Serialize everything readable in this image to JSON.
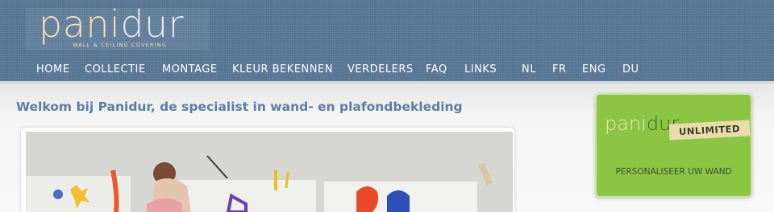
{
  "logo": {
    "pan": "pani",
    "dur": "dur",
    "tagline": "WALL & CEILING COVERING"
  },
  "nav": {
    "items": [
      "HOME",
      "COLLECTIE",
      "MONTAGE",
      "KLEUR BEKENNEN",
      "VERDELERS",
      "FAQ",
      "LINKS"
    ],
    "languages": [
      "NL",
      "FR",
      "ENG",
      "DU"
    ]
  },
  "main": {
    "welcome_title": "Welkom bij Panidur, de specialist in wand- en plafondbekleding"
  },
  "promo": {
    "logo_pan": "pani",
    "logo_dur": "dur",
    "badge": "UNLIMITED",
    "cta": "PERSONALISEER UW WAND"
  },
  "colors": {
    "header": "#587593",
    "title": "#5b7ea3",
    "promo_bg": "#8cc544",
    "logo_cream": "#f3e1b3"
  }
}
